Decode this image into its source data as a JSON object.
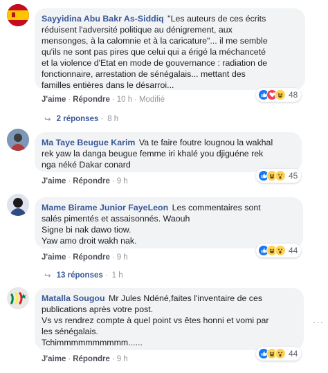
{
  "colors": {
    "bubble_bg": "#f2f3f5",
    "author": "#385898",
    "meta": "#606770",
    "like": "#1877f2",
    "love": "#f33e58",
    "haha": "#fcd354"
  },
  "comments": [
    {
      "author": "Sayyidina Abu Bakr As-Siddiq",
      "lines": [
        "\"Les auteurs de ces écrits",
        "réduisent l'adversité politique au dénigrement, aux",
        "mensonges, à la calomnie et à la caricature\"... il me semble",
        "qu'ils ne sont pas pires que celui qui a érigé la méchanceté",
        "et la violence d'Etat en mode de gouvernance : radiation de",
        "fonctionnaire, arrestation de sénégalais... mettant des",
        "familles entières dans le désarroi..."
      ],
      "like_label": "J'aime",
      "reply_label": "Répondre",
      "time": "10 h",
      "edited": "Modifié",
      "reactions": [
        "like-icon",
        "love-icon",
        "haha-icon"
      ],
      "reaction_count": "48",
      "replies_label": "2 réponses",
      "replies_time": "8 h"
    },
    {
      "author": "Ma Taye Beugue Karim",
      "lines": [
        "Va te faire foutre lougnou la wakhal",
        "rek yaw la danga beugue femme iri khalé you djiguéne rek",
        "nga néké Dakar conard"
      ],
      "like_label": "J'aime",
      "reply_label": "Répondre",
      "time": "9 h",
      "reactions": [
        "like-icon",
        "haha-icon",
        "wow-icon"
      ],
      "reaction_count": "45"
    },
    {
      "author": "Mame Birame Junior FayeLeon",
      "lines": [
        "Les commentaires sont",
        "salés pimentés et assaisonnés. Waouh",
        "Signe bi nak dawo tiow.",
        "Yaw amo droit wakh nak."
      ],
      "like_label": "J'aime",
      "reply_label": "Répondre",
      "time": "9 h",
      "reactions": [
        "like-icon",
        "haha-icon",
        "wow-icon"
      ],
      "reaction_count": "44",
      "replies_label": "13 réponses",
      "replies_time": "1 h"
    },
    {
      "author": "Matalla Sougou",
      "lines": [
        "Mr Jules Ndéné,faites l'inventaire de ces",
        "publications après votre post.",
        "Vs vs rendrez compte à quel point vs êtes honni et vomi par",
        "les sénégalais.",
        "Tchimmmmmmmmmm......"
      ],
      "like_label": "J'aime",
      "reply_label": "Répondre",
      "time": "9 h",
      "reactions": [
        "like-icon",
        "haha-icon",
        "wow-icon"
      ],
      "reaction_count": "44"
    }
  ]
}
